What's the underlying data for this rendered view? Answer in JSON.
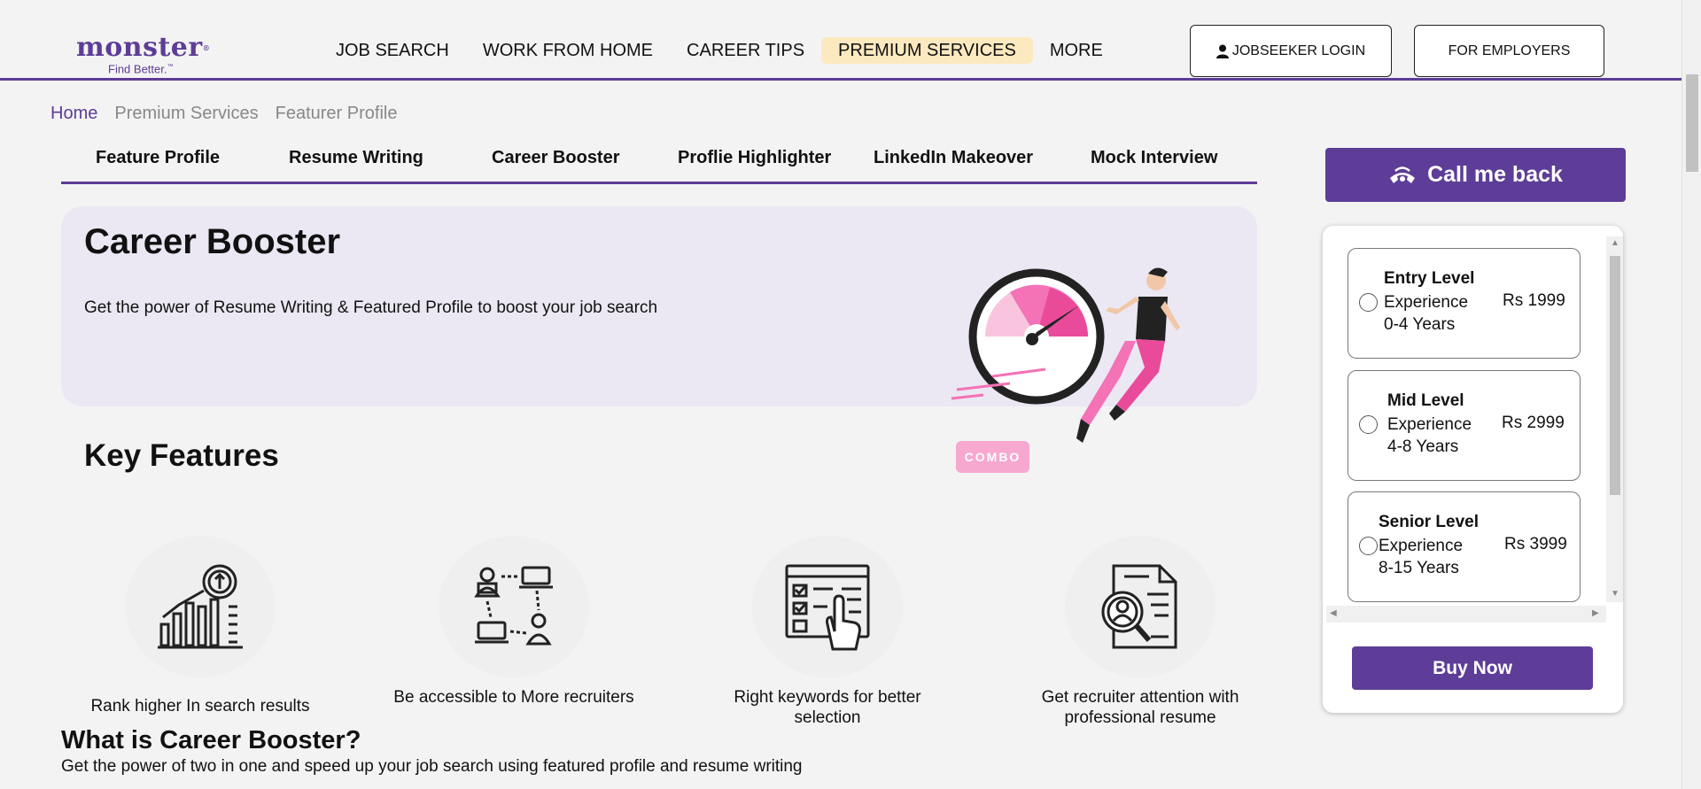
{
  "logo": {
    "word": "monster",
    "tagline": "Find Better."
  },
  "nav": {
    "items": [
      "JOB SEARCH",
      "WORK FROM HOME",
      "CAREER TIPS",
      "PREMIUM SERVICES",
      "MORE"
    ]
  },
  "header": {
    "login_label": "JOBSEEKER LOGIN",
    "employers_label": "FOR EMPLOYERS"
  },
  "breadcrumb": [
    "Home",
    "Premium Services",
    "Featurer Profile"
  ],
  "tabs": [
    "Feature Profile",
    "Resume Writing",
    "Career Booster",
    "Proflie Highlighter",
    "LinkedIn Makeover",
    "Mock Interview"
  ],
  "hero": {
    "title": "Career Booster",
    "subtitle": "Get the power of Resume Writing & Featured Profile to boost your job search",
    "badge": "COMBO"
  },
  "key_features": {
    "title": "Key Features",
    "items": [
      {
        "label": "Rank higher In search results",
        "icon": "ranking-chart-icon"
      },
      {
        "label": "Be accessible to More recruiters",
        "icon": "network-people-icon"
      },
      {
        "label": "Right keywords for better selection",
        "icon": "checklist-click-icon"
      },
      {
        "label": "Get recruiter attention with professional resume",
        "icon": "resume-search-icon"
      }
    ]
  },
  "what": {
    "title": "What is Career Booster?",
    "text": "Get the power of two in one and speed up your job search using featured profile and resume writing"
  },
  "sidebar": {
    "callback_label": "Call me back",
    "plans": [
      {
        "name": "Entry Level",
        "exp_label": "Experience",
        "exp_range": "0-4 Years",
        "price": "Rs 1999"
      },
      {
        "name": "Mid Level",
        "exp_label": "Experience",
        "exp_range": "4-8 Years",
        "price": "Rs 2999"
      },
      {
        "name": "Senior Level",
        "exp_label": "Experience",
        "exp_range": "8-15 Years",
        "price": "Rs 3999"
      }
    ],
    "buy_label": "Buy Now"
  },
  "colors": {
    "brand": "#5d3d97",
    "highlight": "#fde9bf",
    "hero_bg": "#ebe8f3",
    "accent_pink": "#f472b6"
  }
}
